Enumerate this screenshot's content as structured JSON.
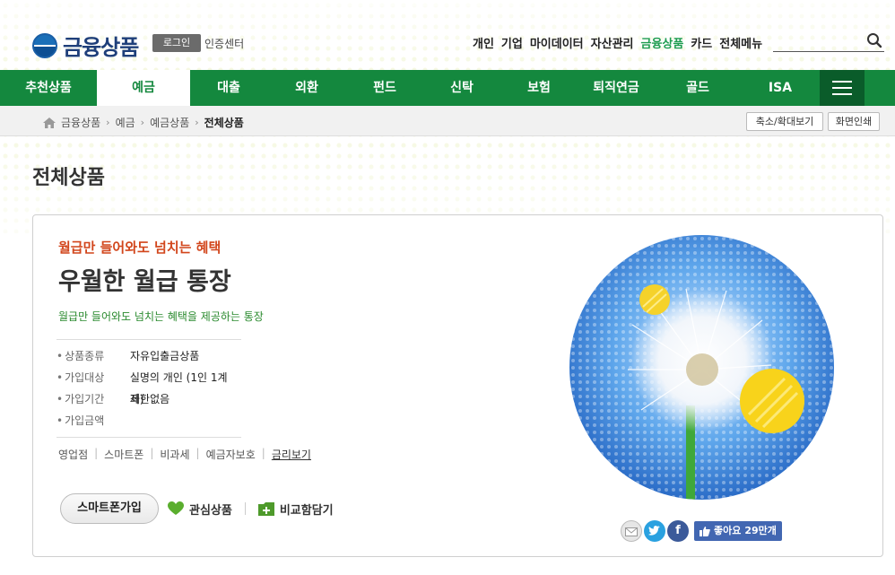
{
  "header": {
    "logo_text": "금융상품",
    "login_label": "로그인",
    "cert_label": "인증센터",
    "top_links": [
      "개인",
      "기업",
      "마이데이터",
      "자산관리",
      "금융상품",
      "카드",
      "전체메뉴"
    ],
    "active_top_link": "금융상품",
    "search_placeholder": ""
  },
  "gnb": {
    "items": [
      "추천상품",
      "예금",
      "대출",
      "외환",
      "펀드",
      "신탁",
      "보험",
      "퇴직연금",
      "골드",
      "ISA"
    ],
    "active": "예금"
  },
  "breadcrumb": {
    "items": [
      "금융상품",
      "예금",
      "예금상품",
      "전체상품"
    ],
    "zoom_button": "축소/확대보기",
    "print_button": "화면인쇄"
  },
  "page_title": "전체상품",
  "product": {
    "subtitle": "월급만 들어와도 넘치는 혜택",
    "title": "우월한 월급 통장",
    "description": "월급만 들어와도 넘치는 혜택을 제공하는 통장",
    "info": [
      {
        "key": "상품종류",
        "value": "자유입출금상품"
      },
      {
        "key": "가입대상",
        "value": "실명의 개인 (1인 1계좌)"
      },
      {
        "key": "가입기간",
        "value": "제한없음"
      },
      {
        "key": "가입금액",
        "value": ""
      }
    ],
    "links": [
      "영업점",
      "스마트폰",
      "비과세",
      "예금자보호",
      "금리보기"
    ],
    "smart_button": "스마트폰가입",
    "interest_label": "관심상품",
    "compare_label": "비교함담기",
    "like_label": "좋아요",
    "like_count": "29만개"
  },
  "colors": {
    "brand_green": "#14883e",
    "accent_orange": "#d2461c",
    "desc_green": "#2a8a2e",
    "logo_blue": "#1f3f7a"
  }
}
